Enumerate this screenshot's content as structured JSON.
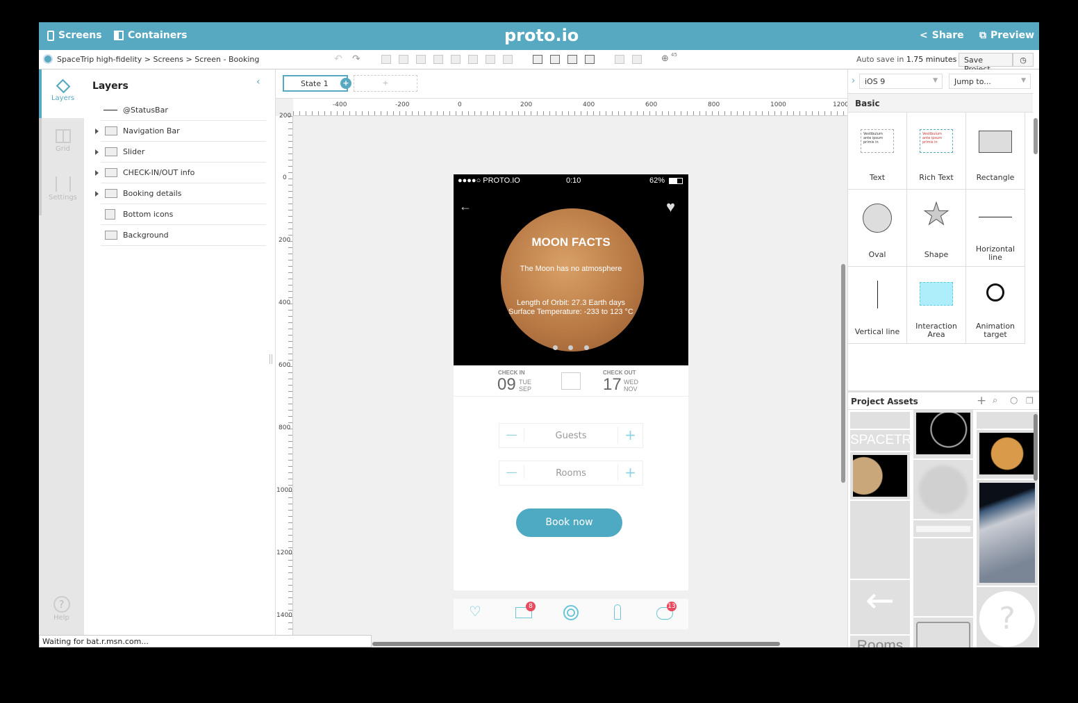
{
  "topbar": {
    "screens": "Screens",
    "containers": "Containers",
    "logo": "proto.io",
    "share": "Share",
    "preview": "Preview"
  },
  "toolbar": {
    "breadcrumb": "SpaceTrip high-fidelity > Screens > Screen - Booking",
    "zoom": "45",
    "autosave_prefix": "Auto save in ",
    "autosave_time": "1.75 minutes",
    "save_project": "Save Project"
  },
  "rail": [
    {
      "label": "Layers"
    },
    {
      "label": "Grid"
    },
    {
      "label": "Settings"
    },
    {
      "label": "Help"
    }
  ],
  "layers": {
    "title": "Layers",
    "items": [
      "@StatusBar",
      "Navigation Bar",
      "Slider",
      "CHECK-IN/OUT info",
      "Booking details",
      "Bottom icons",
      "Background"
    ]
  },
  "states": {
    "current": "State 1",
    "add": "+"
  },
  "rulers": {
    "h": [
      "-400",
      "-200",
      "0",
      "200",
      "400",
      "600",
      "800",
      "1000",
      "1200"
    ],
    "v": [
      "200",
      "0",
      "200",
      "400",
      "600",
      "800",
      "1000",
      "1200",
      "1400"
    ]
  },
  "phone": {
    "carrier": "●●●●○ PROTO.IO",
    "time": "0:10",
    "battery": "62%",
    "title": "MOON FACTS",
    "fact1": "The Moon has no atmosphere",
    "fact2": "Length of Orbit: 27.3 Earth days",
    "fact3": "Surface Temperature: -233 to 123 °C",
    "checkin_label": "CHECK IN",
    "checkin_day": "09",
    "checkin_dow": "TUE",
    "checkin_mon": "SEP",
    "checkout_label": "CHECK OUT",
    "checkout_day": "17",
    "checkout_dow": "WED",
    "checkout_mon": "NOV",
    "guests": "Guests",
    "rooms": "Rooms",
    "book": "Book now",
    "mail_badge": "8",
    "profile_badge": "13"
  },
  "right": {
    "device": "iOS 9",
    "jump": "Jump to...",
    "section": "Basic",
    "components": [
      "Text",
      "Rich Text",
      "Rectangle",
      "Oval",
      "Shape",
      "Horizontal line",
      "Vertical line",
      "Interaction Area",
      "Animation target"
    ],
    "text_sample": "Vestibulum ante ipsum primis in",
    "assets_title": "Project Assets",
    "asset_spacetrip": "SPACETRIP",
    "asset_rooms": "Rooms"
  },
  "status": "Waiting for bat.r.msn.com...",
  "colors": {
    "accent": "#57a8c1",
    "badge": "#e84a5f"
  }
}
